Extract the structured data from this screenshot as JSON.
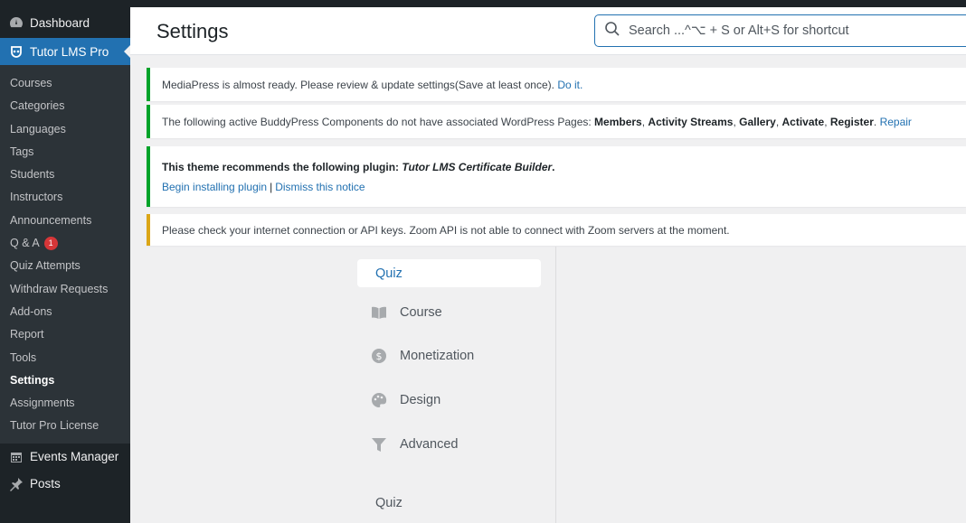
{
  "sidebar": {
    "dashboard": "Dashboard",
    "plugin": "Tutor LMS Pro",
    "items": [
      {
        "label": "Courses"
      },
      {
        "label": "Categories"
      },
      {
        "label": "Languages"
      },
      {
        "label": "Tags"
      },
      {
        "label": "Students"
      },
      {
        "label": "Instructors"
      },
      {
        "label": "Announcements"
      },
      {
        "label": "Q & A",
        "badge": "1"
      },
      {
        "label": "Quiz Attempts"
      },
      {
        "label": "Withdraw Requests"
      },
      {
        "label": "Add-ons"
      },
      {
        "label": "Report"
      },
      {
        "label": "Tools"
      },
      {
        "label": "Settings"
      },
      {
        "label": "Assignments"
      },
      {
        "label": "Tutor Pro License"
      }
    ],
    "events": "Events Manager",
    "posts": "Posts"
  },
  "header": {
    "title": "Settings",
    "search_placeholder": "Search ...^⌥ + S or Alt+S for shortcut"
  },
  "notices": {
    "mediapress": {
      "text": "MediaPress is almost ready. Please review & update settings(Save at least once). ",
      "link": "Do it."
    },
    "buddypress": {
      "prefix": "The following active BuddyPress Components do not have associated WordPress Pages: ",
      "c1": "Members",
      "c2": "Activity Streams",
      "c3": "Gallery",
      "c4": "Activate",
      "c5": "Register",
      "link": "Repair"
    },
    "theme": {
      "prefix": "This theme recommends the following plugin: ",
      "plugin": "Tutor LMS Certificate Builder",
      "install": "Begin installing plugin",
      "dismiss": "Dismiss this notice"
    },
    "zoom": "Please check your internet connection or API keys. Zoom API is not able to connect with Zoom servers at the moment."
  },
  "tabs": {
    "quiz": "Quiz",
    "course": "Course",
    "monetization": "Monetization",
    "design": "Design",
    "advanced": "Advanced"
  },
  "section_label": "Quiz",
  "colors": {
    "accent": "#2271b1",
    "sidebar_bg": "#1d2327",
    "badge": "#d63638",
    "notice_success": "#00a32a",
    "notice_warning": "#dba617"
  }
}
